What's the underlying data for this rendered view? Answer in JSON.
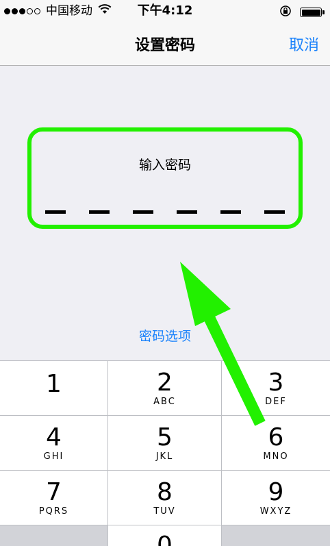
{
  "status_bar": {
    "carrier": "中国移动",
    "time": "下午4:12",
    "signal_filled": 3,
    "signal_empty": 2
  },
  "nav": {
    "title": "设置密码",
    "cancel_label": "取消"
  },
  "passcode": {
    "prompt": "输入密码",
    "digits": 6,
    "highlight_color": "#22f000"
  },
  "options_link": "密码选项",
  "keypad": {
    "keys": [
      {
        "digit": "1",
        "letters": ""
      },
      {
        "digit": "2",
        "letters": "ABC"
      },
      {
        "digit": "3",
        "letters": "DEF"
      },
      {
        "digit": "4",
        "letters": "GHI"
      },
      {
        "digit": "5",
        "letters": "JKL"
      },
      {
        "digit": "6",
        "letters": "MNO"
      },
      {
        "digit": "7",
        "letters": "PQRS"
      },
      {
        "digit": "8",
        "letters": "TUV"
      },
      {
        "digit": "9",
        "letters": "WXYZ"
      }
    ],
    "bottom_digit": "0"
  },
  "colors": {
    "accent": "#1a82fb",
    "annotation": "#22f000"
  }
}
